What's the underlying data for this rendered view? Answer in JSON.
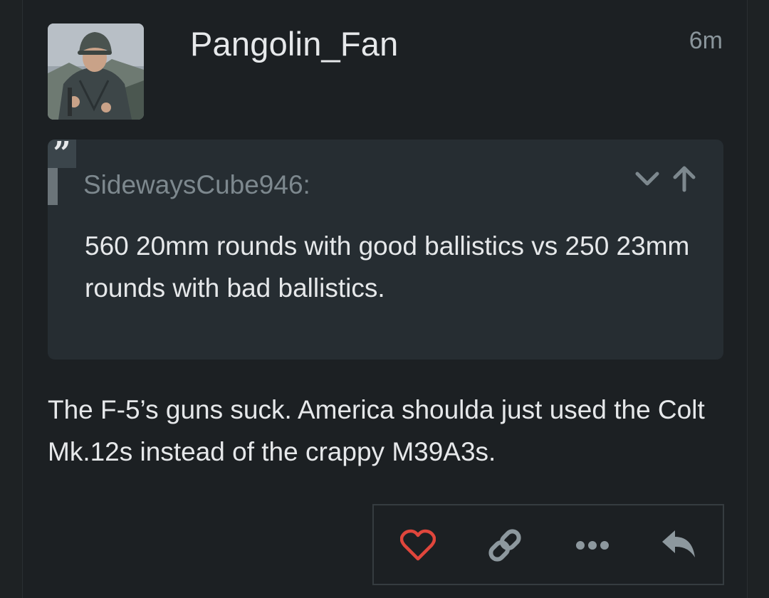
{
  "post": {
    "username": "Pangolin_Fan",
    "timestamp": "6m",
    "avatar_icon": "soldier-avatar",
    "quote": {
      "mark": "”",
      "author": "SidewaysCube946:",
      "text": "560 20mm rounds with good ballistics vs 250 23mm rounds with bad ballistics."
    },
    "body": "The F-5’s guns suck. America shoulda just used the Colt Mk.12s instead of the crappy M39A3s."
  },
  "actions": {
    "like_icon": "heart-icon",
    "link_icon": "link-icon",
    "more_icon": "ellipsis-icon",
    "reply_icon": "reply-icon"
  },
  "colors": {
    "heart": "#e0463c",
    "icon_gray": "#8d989e",
    "text": "#e6e8ea",
    "muted": "#7d888e",
    "quote_bg": "#262d32",
    "post_bg": "#1c2023"
  }
}
